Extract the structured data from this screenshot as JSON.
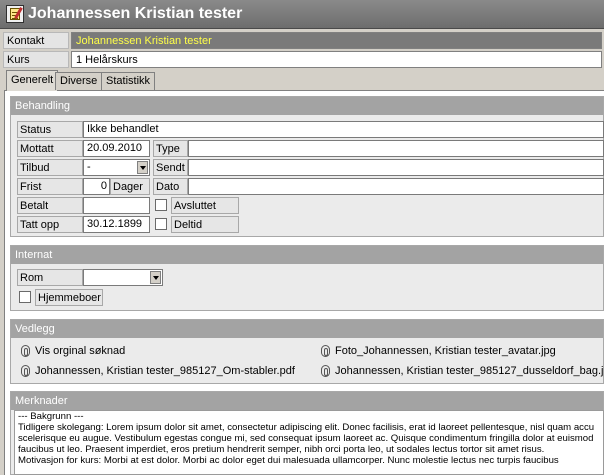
{
  "window": {
    "title": "Johannessen Kristian tester",
    "icon": "notepad-icon"
  },
  "kontakt": {
    "label": "Kontakt",
    "value": "Johannessen Kristian tester",
    "value_color": "#ffff48"
  },
  "kurs": {
    "label": "Kurs",
    "value": "1 Helårskurs"
  },
  "tabs": [
    {
      "label": "Generelt",
      "active": true
    },
    {
      "label": "Diverse",
      "active": false
    },
    {
      "label": "Statistikk",
      "active": false
    }
  ],
  "behandling": {
    "header": "Behandling",
    "status": {
      "label": "Status",
      "value": "Ikke behandlet"
    },
    "mottatt": {
      "label": "Mottatt",
      "value": "20.09.2010"
    },
    "type": {
      "label": "Type",
      "value": ""
    },
    "tilbud": {
      "label": "Tilbud",
      "value": "-"
    },
    "sendt": {
      "label": "Sendt",
      "value": ""
    },
    "frist": {
      "label": "Frist",
      "value": "0",
      "unit": "Dager"
    },
    "dato": {
      "label": "Dato",
      "value": ""
    },
    "betalt": {
      "label": "Betalt",
      "value": ""
    },
    "avsluttet": {
      "label": "Avsluttet",
      "checked": false
    },
    "tatt_opp": {
      "label": "Tatt opp",
      "value": "30.12.1899"
    },
    "deltid": {
      "label": "Deltid",
      "checked": false
    }
  },
  "internat": {
    "header": "Internat",
    "rom": {
      "label": "Rom",
      "value": ""
    },
    "hjemmeboer": {
      "label": "Hjemmeboer",
      "checked": false
    }
  },
  "vedlegg": {
    "header": "Vedlegg",
    "items": [
      {
        "name": "Vis orginal søknad",
        "icon": "paperclip-icon"
      },
      {
        "name": "Foto_Johannessen, Kristian tester_avatar.jpg",
        "icon": "paperclip-icon"
      },
      {
        "name": "Johannessen, Kristian tester_985127_Om-stabler.pdf",
        "icon": "paperclip-icon"
      },
      {
        "name": "Johannessen, Kristian tester_985127_dusseldorf_bag.jpg",
        "icon": "paperclip-icon"
      }
    ]
  },
  "merknader": {
    "header": "Merknader",
    "lines": [
      "--- Bakgrunn ---",
      "Tidligere skolegang: Lorem ipsum dolor sit amet, consectetur adipiscing elit. Donec facilisis, erat id laoreet pellentesque, nisl quam accu",
      "scelerisque eu augue. Vestibulum egestas congue mi, sed consequat ipsum laoreet ac. Quisque condimentum fringilla dolor at euismod",
      "faucibus ut leo. Praesent imperdiet, eros pretium hendrerit semper, nibh orci porta leo, ut sodales lectus tortor sit amet risus.",
      "Motivasjon for kurs: Morbi at est dolor. Morbi ac dolor eget dui malesuada ullamcorper. Nunc molestie lectus nec turpis faucibus"
    ]
  }
}
